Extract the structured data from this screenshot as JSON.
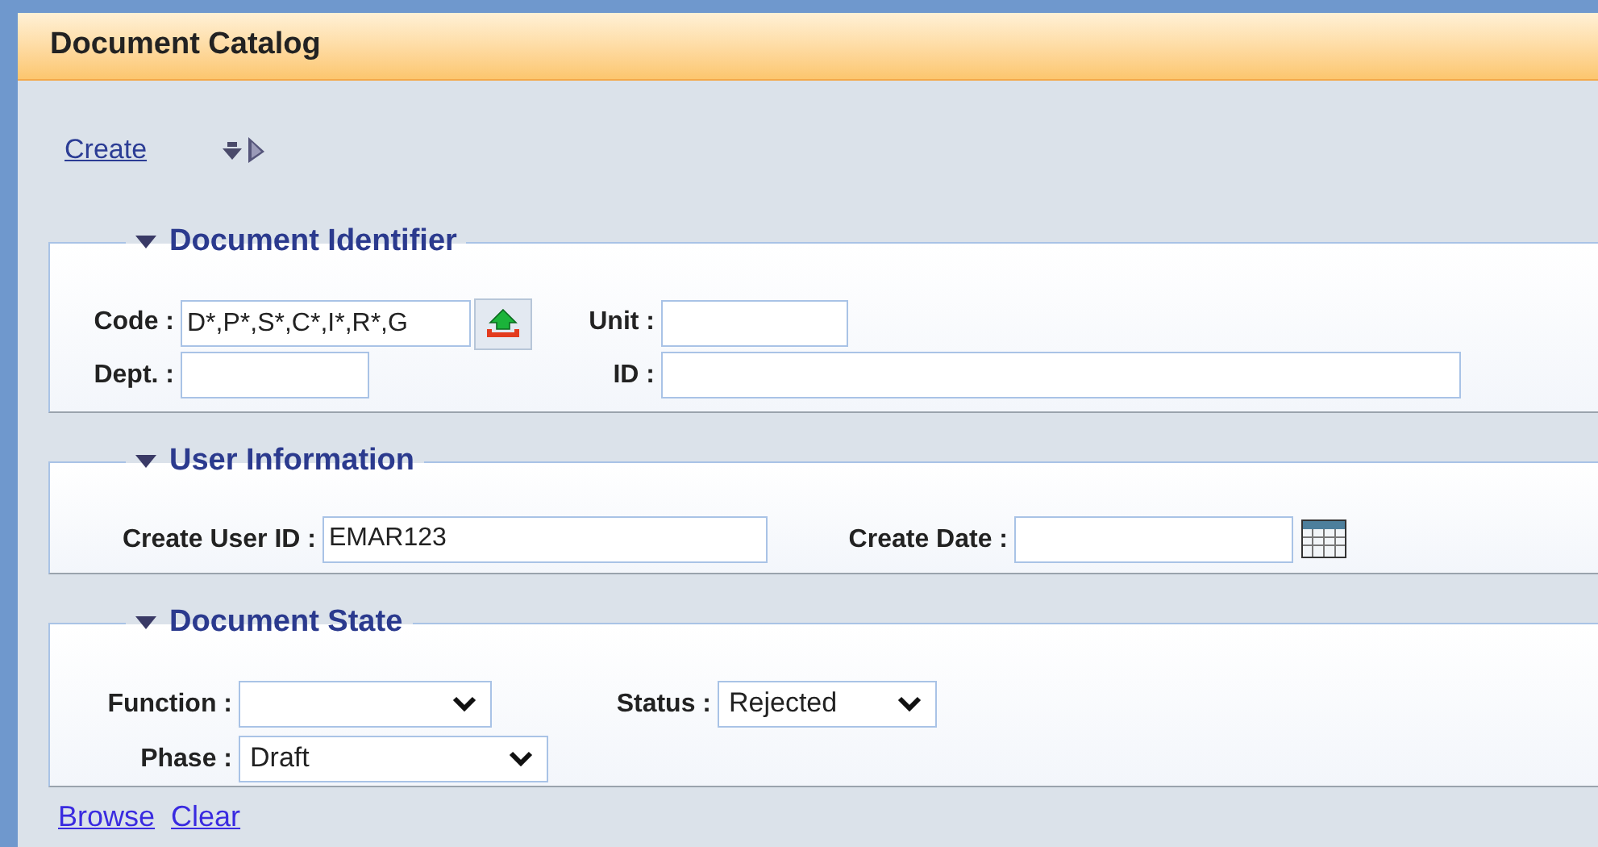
{
  "window": {
    "title": "Document Catalog"
  },
  "toolbar": {
    "create_link": "Create"
  },
  "sections": [
    {
      "legend": "Document Identifier",
      "expanded": true,
      "rows": [
        [
          {
            "kind": "lookup",
            "label": "Code :",
            "value": "D*,P*,S*,C*,I*,R*,G"
          },
          {
            "kind": "text",
            "label": "Unit :"
          }
        ],
        [
          {
            "kind": "text",
            "label": "Dept. :"
          },
          {
            "kind": "text",
            "label": "ID :"
          }
        ]
      ]
    },
    {
      "legend": "User Information",
      "expanded": true,
      "rows": [
        [
          {
            "kind": "text",
            "label": "Create User ID :",
            "value": "EMAR123"
          },
          {
            "kind": "date",
            "label": "Create Date :"
          }
        ]
      ]
    },
    {
      "legend": "Document State",
      "expanded": true,
      "rows": [
        [
          {
            "kind": "select",
            "label": "Function :"
          },
          {
            "kind": "select",
            "label": "Status :",
            "value": "Rejected"
          }
        ],
        [
          {
            "kind": "select",
            "label": "Phase :",
            "value": "Draft"
          }
        ]
      ]
    }
  ],
  "links": [
    "Browse",
    "Clear"
  ]
}
